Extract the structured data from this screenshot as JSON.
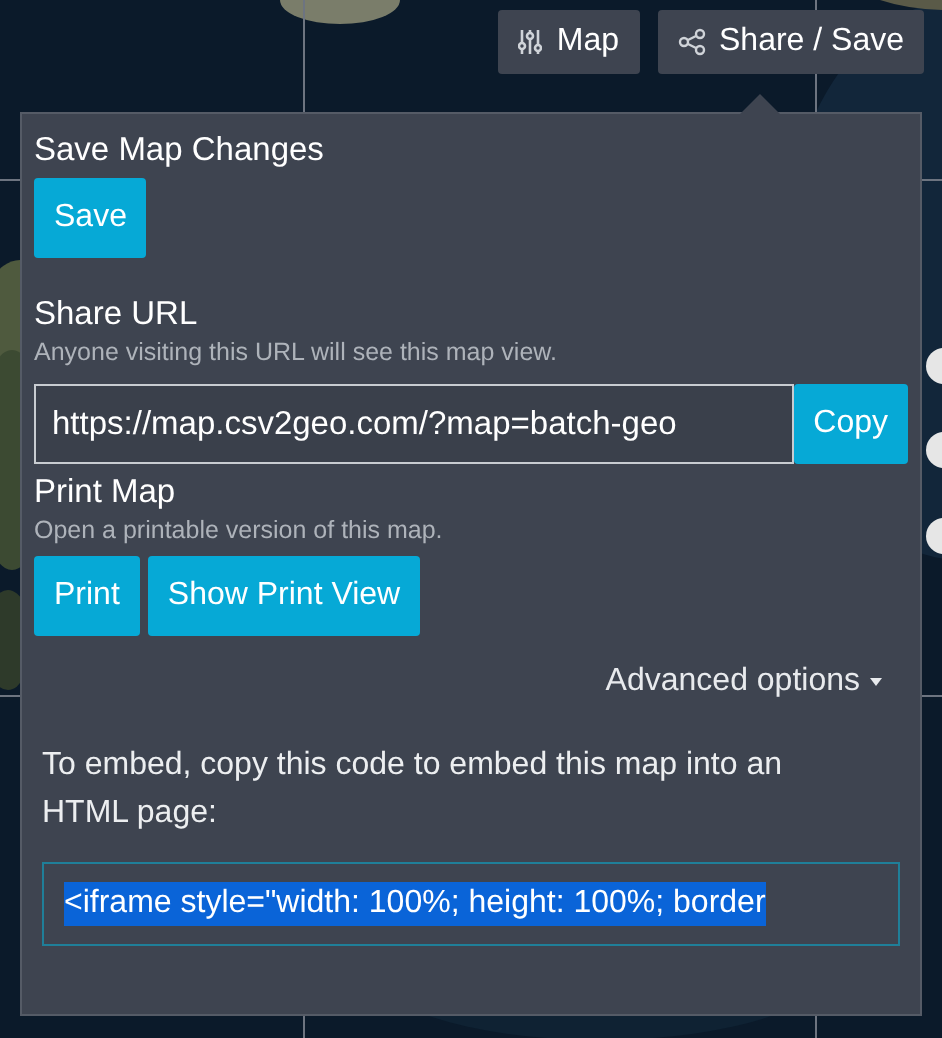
{
  "top_bar": {
    "buttons": [
      {
        "label": "Map"
      },
      {
        "label": "Share / Save"
      }
    ]
  },
  "panel": {
    "save": {
      "heading": "Save Map Changes",
      "button": "Save"
    },
    "share": {
      "heading": "Share URL",
      "hint": "Anyone visiting this URL will see this map view.",
      "url": "https://map.csv2geo.com/?map=batch-geo",
      "button": "Copy"
    },
    "print": {
      "heading": "Print Map",
      "hint": "Open a printable version of this map.",
      "buttons": [
        "Print",
        "Show Print View"
      ]
    },
    "advanced": {
      "label": "Advanced options",
      "expanded": true
    },
    "embed": {
      "text": "To embed, copy this code to embed this map into an HTML page:",
      "code": "<iframe style=\"width: 100%; height: 100%; border",
      "highlighted": true
    }
  }
}
